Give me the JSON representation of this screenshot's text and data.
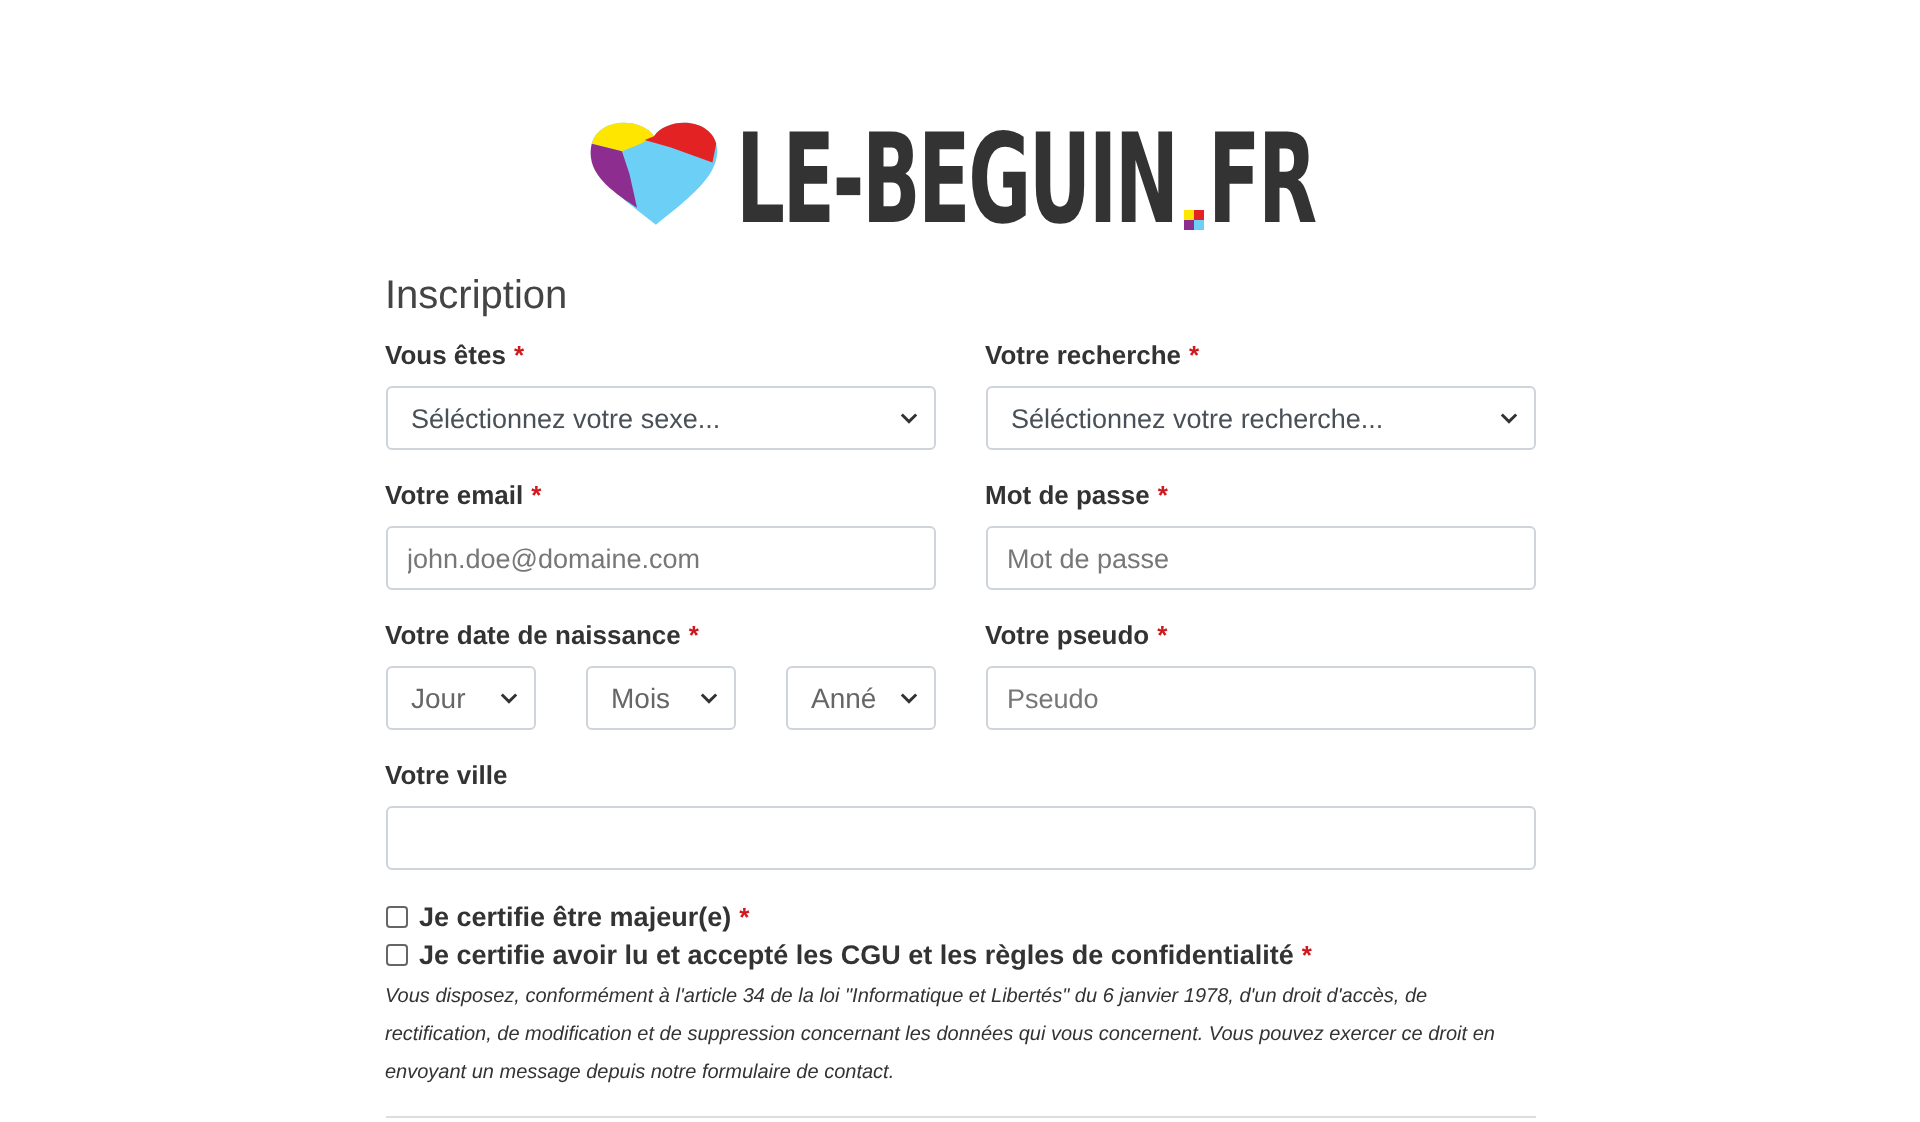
{
  "logo": {
    "name": "LE-BEGUIN",
    "tld": "FR"
  },
  "title": "Inscription",
  "fields": [
    {
      "kind": "select",
      "label": "Vous êtes",
      "mark": "*",
      "value": "Séléctionnez votre sexe..."
    },
    {
      "kind": "select",
      "label": "Votre recherche",
      "mark": "*",
      "value": "Séléctionnez votre recherche..."
    },
    {
      "kind": "input",
      "label": "Votre email",
      "mark": "*",
      "placeholder": "john.doe@domaine.com"
    },
    {
      "kind": "input",
      "label": "Mot de passe",
      "mark": "*",
      "placeholder": "Mot de passe"
    },
    {
      "kind": "date",
      "label": "Votre date de naissance",
      "mark": "*",
      "parts": [
        "Jour",
        "Mois",
        "Anné"
      ]
    },
    {
      "kind": "input",
      "label": "Votre pseudo",
      "mark": "*",
      "placeholder": "Pseudo"
    },
    {
      "kind": "wide",
      "label": "Votre ville"
    }
  ],
  "checks": [
    {
      "label": "Je certifie être majeur(e)",
      "mark": "*",
      "checked": false
    },
    {
      "label": "Je certifie avoir lu et accepté les CGU et les règles de confidentialité",
      "mark": "*",
      "checked": false
    }
  ],
  "legal": "Vous disposez, conformément à l'article 34 de la loi \"Informatique et Libertés\" du 6 janvier 1978, d'un droit d'accès, de rectification, de modification et de suppression concernant les données qui vous concernent. Vous pouvez exercer ce droit en envoyant un message depuis notre formulaire de contact."
}
